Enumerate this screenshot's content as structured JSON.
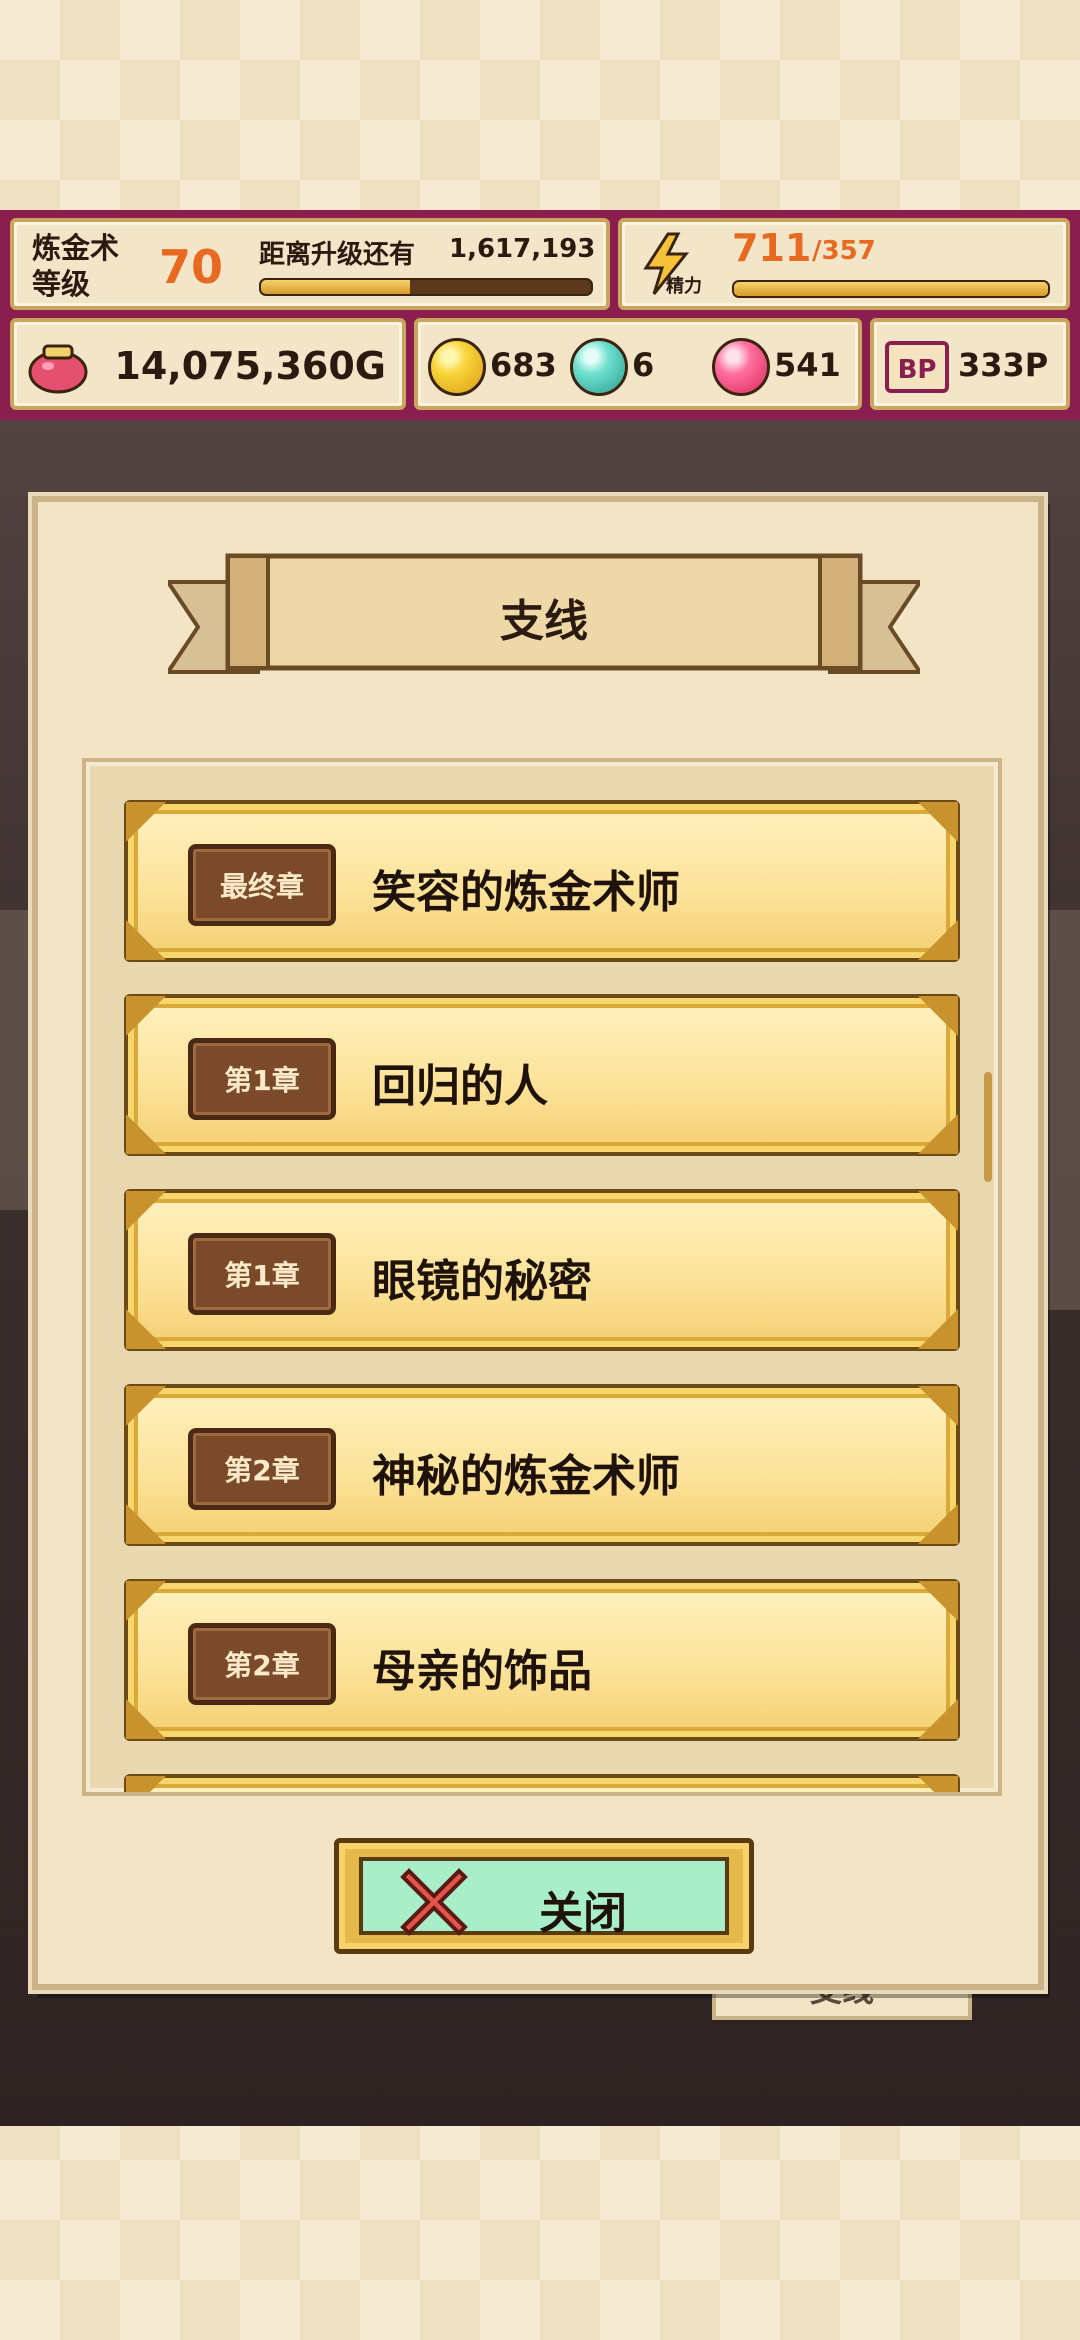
{
  "hud": {
    "level_label": "炼金术 等级",
    "level_value": "70",
    "exp_label": "距离升级还有",
    "exp_value": "1,617,193",
    "exp_progress": 0.45,
    "energy_sub": "精力",
    "energy_value": "711",
    "energy_max": "/357",
    "energy_progress": 1.0,
    "gold": "14,075,360G",
    "gem_yellow": "683",
    "gem_cyan": "6",
    "gem_pink": "541",
    "bp": "333P"
  },
  "dialog": {
    "title": "支线",
    "quests": [
      {
        "chapter": "最终章",
        "title": "笑容的炼金术师"
      },
      {
        "chapter": "第1章",
        "title": "回归的人"
      },
      {
        "chapter": "第1章",
        "title": "眼镜的秘密"
      },
      {
        "chapter": "第2章",
        "title": "神秘的炼金术师"
      },
      {
        "chapter": "第2章",
        "title": "母亲的饰品"
      }
    ],
    "close_label": "关闭"
  },
  "background": {
    "side_button": "支线"
  },
  "colors": {
    "hud_bg": "#8a1e4e",
    "accent_orange": "#e86a22",
    "close_button_bg": "#a8efc9",
    "close_x": "#e5544b"
  }
}
